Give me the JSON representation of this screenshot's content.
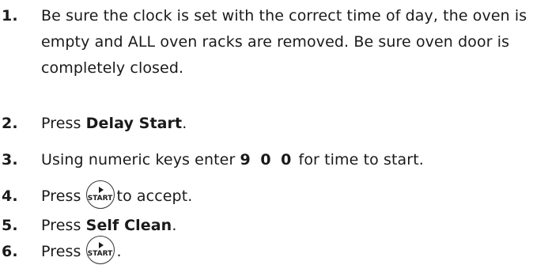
{
  "steps": [
    {
      "number": "1.",
      "text": "Be sure the clock is set with the correct time of day, the oven is empty and ALL oven racks are removed. Be sure oven door is completely closed."
    },
    {
      "number": "2.",
      "prefix": "Press ",
      "bold": "Delay Start",
      "suffix": "."
    },
    {
      "number": "3.",
      "prefix": "Using numeric keys enter ",
      "bold": "9 0 0",
      "suffix": " for time to start."
    },
    {
      "number": "4.",
      "prefix": "Press",
      "key_label": "START",
      "key_icon": "play-triangle-icon",
      "suffix": "to accept."
    },
    {
      "number": "5.",
      "prefix": "Press ",
      "bold": "Self Clean",
      "suffix": "."
    },
    {
      "number": "6.",
      "prefix": "Press",
      "key_label": "START",
      "key_icon": "play-triangle-icon",
      "suffix": "."
    }
  ]
}
